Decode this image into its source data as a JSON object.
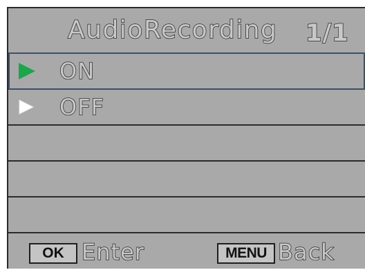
{
  "header": {
    "title": "AudioRecording",
    "page": "1/1"
  },
  "menu": {
    "items": [
      {
        "label": "ON",
        "selected": true,
        "icon": "play-arrow-icon"
      },
      {
        "label": "OFF",
        "selected": false,
        "icon": "play-arrow-icon"
      }
    ]
  },
  "footer": {
    "ok_key": "OK",
    "ok_action": "Enter",
    "menu_key": "MENU",
    "menu_action": "Back"
  },
  "colors": {
    "background": "#a9a9a9",
    "selected_arrow": "#1aa64a",
    "unselected_arrow": "#ffffff",
    "selection_outline": "#3a5068"
  }
}
